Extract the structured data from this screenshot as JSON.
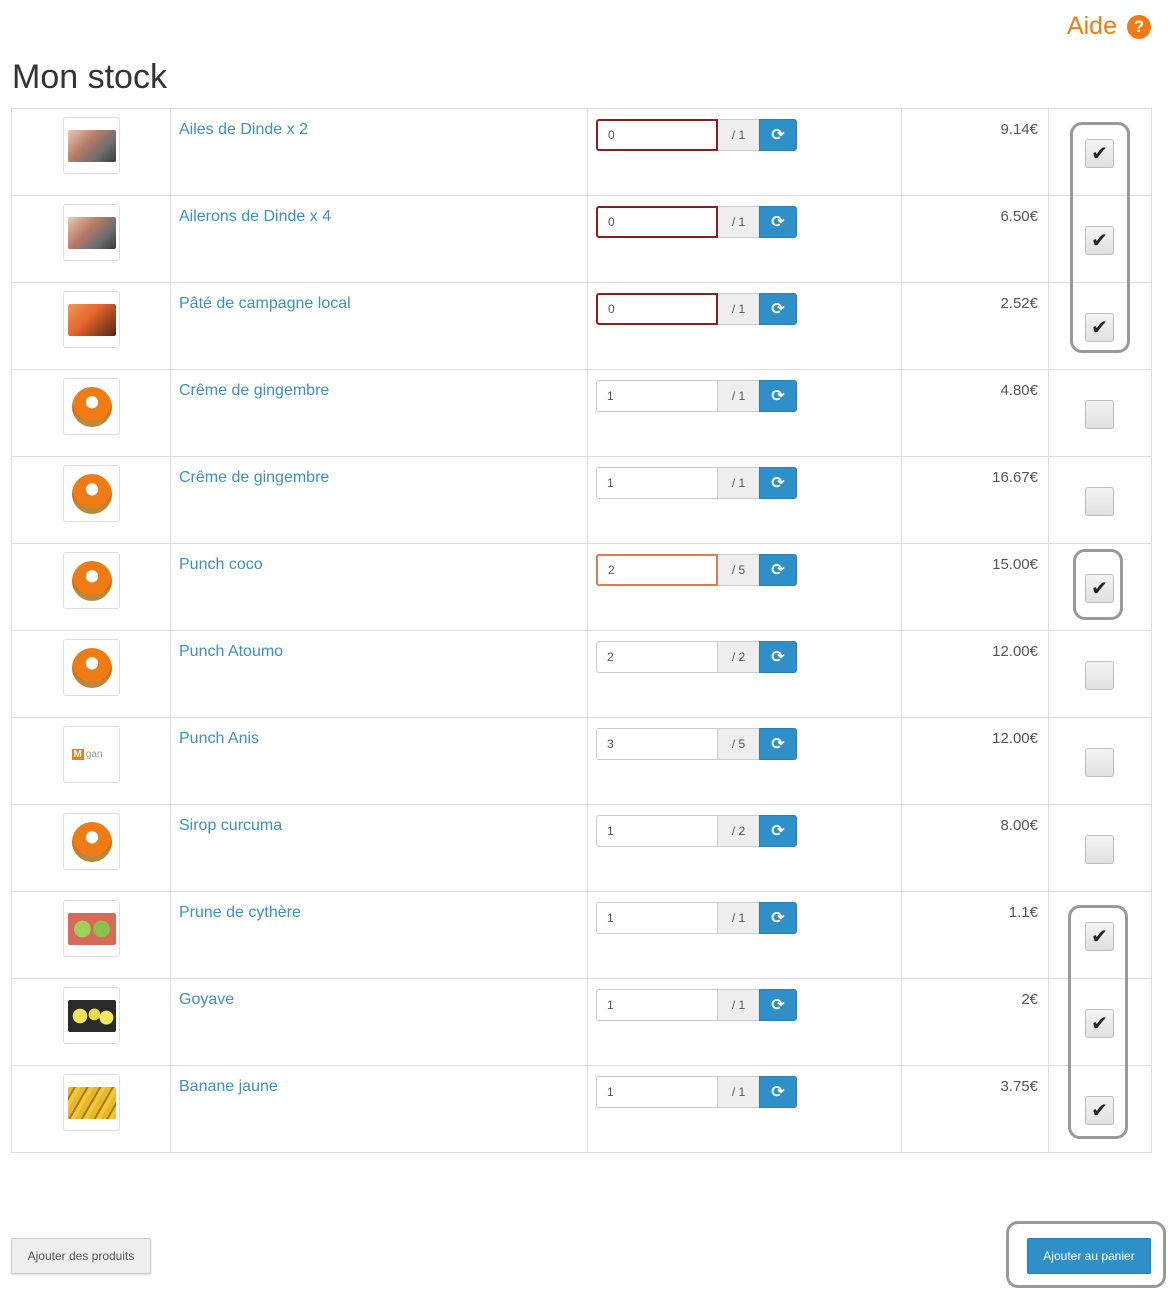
{
  "help": {
    "label": "Aide",
    "icon": "help-circle-icon",
    "color": "#f07a14"
  },
  "page": {
    "title": "Mon stock"
  },
  "products": [
    {
      "name": "Ailes de Dinde x 2",
      "thumb": "meat",
      "qty": "0",
      "max": "/ 1",
      "price": "9.14€",
      "checked": true,
      "qty_state": "error"
    },
    {
      "name": "Ailerons de Dinde x 4",
      "thumb": "meat",
      "qty": "0",
      "max": "/ 1",
      "price": "6.50€",
      "checked": true,
      "qty_state": "error"
    },
    {
      "name": "Pâté de campagne local",
      "thumb": "pate",
      "qty": "0",
      "max": "/ 1",
      "price": "2.52€",
      "checked": true,
      "qty_state": "error"
    },
    {
      "name": "Crême de gingembre",
      "thumb": "logo",
      "qty": "1",
      "max": "/ 1",
      "price": "4.80€",
      "checked": false,
      "qty_state": "normal"
    },
    {
      "name": "Crême de gingembre",
      "thumb": "logo",
      "qty": "1",
      "max": "/ 1",
      "price": "16.67€",
      "checked": false,
      "qty_state": "normal"
    },
    {
      "name": "Punch coco",
      "thumb": "logo",
      "qty": "2",
      "max": "/ 5",
      "price": "15.00€",
      "checked": true,
      "qty_state": "warning"
    },
    {
      "name": "Punch Atoumo",
      "thumb": "logo",
      "qty": "2",
      "max": "/ 2",
      "price": "12.00€",
      "checked": false,
      "qty_state": "normal"
    },
    {
      "name": "Punch Anis",
      "thumb": "brand",
      "qty": "3",
      "max": "/ 5",
      "price": "12.00€",
      "checked": false,
      "qty_state": "normal"
    },
    {
      "name": "Sirop curcuma",
      "thumb": "logo",
      "qty": "1",
      "max": "/ 2",
      "price": "8.00€",
      "checked": false,
      "qty_state": "normal"
    },
    {
      "name": "Prune de cythère",
      "thumb": "prune",
      "qty": "1",
      "max": "/ 1",
      "price": "1.1€",
      "checked": true,
      "qty_state": "normal"
    },
    {
      "name": "Goyave",
      "thumb": "goyave",
      "qty": "1",
      "max": "/ 1",
      "price": "2€",
      "checked": true,
      "qty_state": "normal"
    },
    {
      "name": "Banane jaune",
      "thumb": "banane",
      "qty": "1",
      "max": "/ 1",
      "price": "3.75€",
      "checked": true,
      "qty_state": "normal"
    }
  ],
  "thumb_brand_text": "gan",
  "thumb_brand_letter": "M",
  "refresh_icon": "refresh-icon",
  "check_icon": "checkmark-icon",
  "buttons": {
    "add_products": "Ajouter des produits",
    "add_to_cart": "Ajouter au panier"
  },
  "colors": {
    "accent": "#2e8fc9",
    "link": "#3d8fc7",
    "error_border": "#8b1e1e",
    "warning_border": "#e07a52"
  }
}
